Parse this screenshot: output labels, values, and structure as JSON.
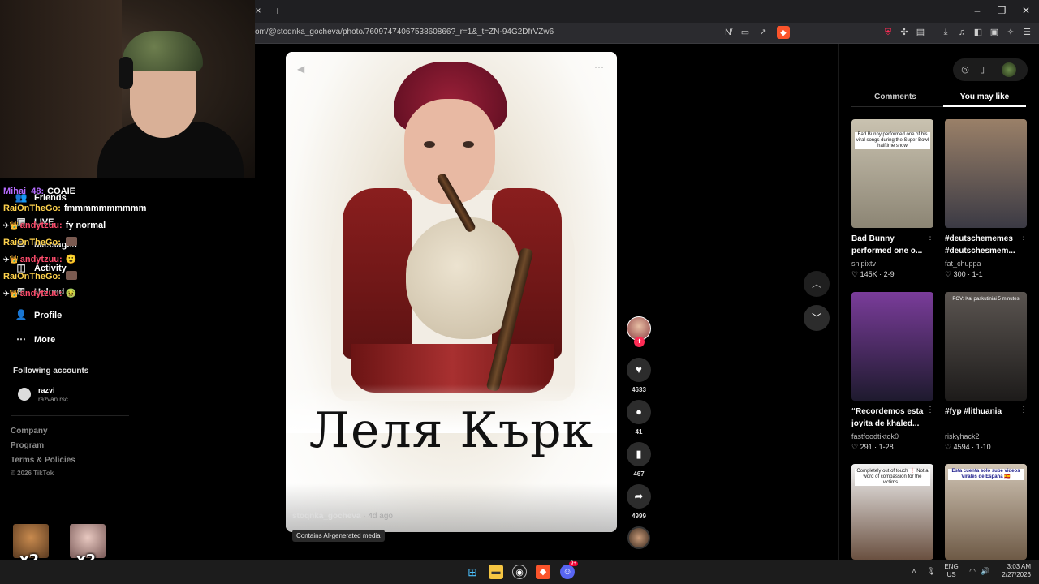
{
  "browser": {
    "tab_close": "×",
    "new_tab": "+",
    "window_controls": {
      "minimize": "–",
      "maximize": "❐",
      "close": "✕"
    },
    "url": "om/@stoqnka_gocheva/photo/7609747406753860866?_r=1&_t=ZN-94G2DfrVZw6"
  },
  "stream_overlay": {
    "chat": [
      {
        "user": "Mihai_48:",
        "user_color": "#b56cff",
        "message": "COAIE",
        "badge": ""
      },
      {
        "user": "RaiOnTheGo:",
        "user_color": "#ffd34d",
        "message": "fmmmmmmmmmm",
        "badge": ""
      },
      {
        "user": "andytzuu:",
        "user_color": "#ff4d6d",
        "message": "fy normal",
        "badge": "✈👑"
      },
      {
        "user": "RaiOnTheGo:",
        "user_color": "#ffd34d",
        "message": "",
        "badge": ""
      },
      {
        "user": "andytzuu:",
        "user_color": "#ff4d6d",
        "message": "😮",
        "badge": "✈👑"
      },
      {
        "user": "RaiOnTheGo:",
        "user_color": "#ffd34d",
        "message": "",
        "badge": ""
      },
      {
        "user": "andytzuu:",
        "user_color": "#ff4d6d",
        "message": "🤢",
        "badge": "✈👑"
      }
    ],
    "emote_counts": [
      "x2",
      "x2"
    ]
  },
  "sidebar": {
    "nav": [
      {
        "label": "Friends",
        "icon": "friends-icon",
        "glyph": "👥"
      },
      {
        "label": "LIVE",
        "icon": "live-icon",
        "glyph": "▣"
      },
      {
        "label": "Messages",
        "icon": "messages-icon",
        "glyph": "✉"
      },
      {
        "label": "Activity",
        "icon": "activity-icon",
        "glyph": "◫"
      },
      {
        "label": "Upload",
        "icon": "upload-icon",
        "glyph": "⊞"
      },
      {
        "label": "Profile",
        "icon": "profile-icon",
        "glyph": "👤"
      },
      {
        "label": "More",
        "icon": "more-icon",
        "glyph": "⋯"
      }
    ],
    "following_title": "Following accounts",
    "following": [
      {
        "name": "razvi",
        "handle": "razvan.rsc"
      }
    ],
    "footer": [
      "Company",
      "Program",
      "Terms & Policies"
    ],
    "copyright": "© 2026 TikTok"
  },
  "post": {
    "caption_overlay": "Леля Кърк",
    "author": "stoqnka_gocheva",
    "posted": " · 4d ago",
    "ai_label": "Contains AI-generated media",
    "likes": "4633",
    "comments": "41",
    "saves": "467",
    "shares": "4999",
    "follow_plus": "+"
  },
  "right_panel": {
    "tabs": [
      "Comments",
      "You may like"
    ],
    "active_tab": "You may like",
    "recommendations": [
      {
        "title": "Bad Bunny performed one o...",
        "user": "snipixtv",
        "stats": "♡ 145K · 2-9",
        "thumb_text": "Bad Bunny performed one of his viral songs during the Super Bowl halftime show",
        "colors": [
          "#c9c2b0",
          "#8c8574"
        ]
      },
      {
        "title": "#deutschememes #deutschesmem...",
        "user": "fat_chuppa",
        "stats": "♡ 300 · 1-1",
        "thumb_text": "",
        "colors": [
          "#9a8068",
          "#3b3a44"
        ]
      },
      {
        "title": "“Recordemos esta joyita de khaled...",
        "user": "fastfoodtiktok0",
        "stats": "♡ 291 · 1-28",
        "thumb_text": "",
        "colors": [
          "#7a3c9a",
          "#1e1a2e"
        ]
      },
      {
        "title": "#fyp #lithuania",
        "user": "riskyhack2",
        "stats": "♡ 4594 · 1-10",
        "thumb_text": "POV: Kai paskutiniai 5 minutes",
        "colors": [
          "#5a5450",
          "#1d1b1a"
        ]
      },
      {
        "title": "",
        "user": "",
        "stats": "",
        "thumb_text": "Completely out of touch ❗ Not a word of compassion for the victims...",
        "colors": [
          "#f2f2f2",
          "#6a5040"
        ]
      },
      {
        "title": "",
        "user": "",
        "stats": "",
        "thumb_text": "Esta cuenta solo sube videos Virales de España 🇪🇸",
        "colors": [
          "#d0c4b4",
          "#6e5a46"
        ]
      }
    ]
  },
  "taskbar": {
    "lang_top": "ENG",
    "lang_bottom": "US",
    "time": "3:03 AM",
    "date": "2/27/2026",
    "discord_badge": "9+"
  },
  "colors": {
    "tiktok_red": "#fe2c55",
    "brave_orange": "#fb542b",
    "chat_purple": "#b56cff",
    "chat_gold": "#ffd34d",
    "chat_red": "#ff4d6d"
  }
}
